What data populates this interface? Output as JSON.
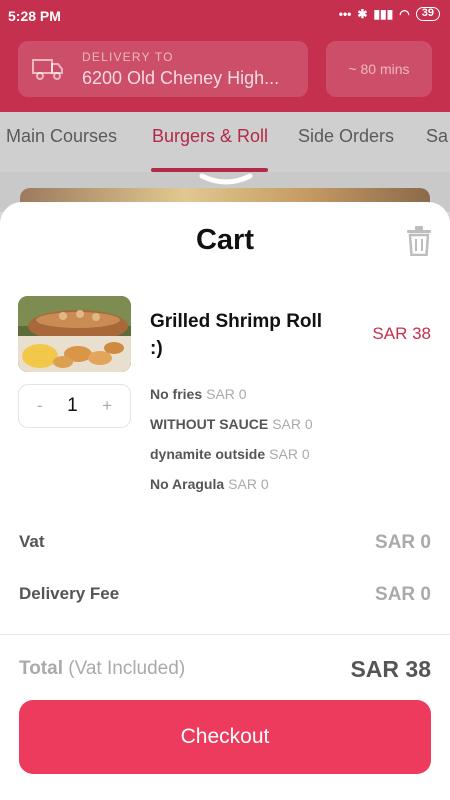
{
  "status": {
    "time": "5:28 PM",
    "battery": "39"
  },
  "header": {
    "delivery_label": "DELIVERY TO",
    "address": "6200 Old Cheney High...",
    "eta": "~ 80 mins"
  },
  "tabs": [
    {
      "label": "Main Courses"
    },
    {
      "label": "Burgers & Roll"
    },
    {
      "label": "Side Orders"
    },
    {
      "label": "Sa"
    }
  ],
  "cart": {
    "title": "Cart",
    "item": {
      "name": "Grilled Shrimp Roll :)",
      "price": "SAR 38",
      "quantity": "1",
      "minus": "-",
      "plus": "+",
      "options": [
        {
          "name": "No fries",
          "price": "SAR 0"
        },
        {
          "name": "WITHOUT SAUCE",
          "price": "SAR 0"
        },
        {
          "name": "dynamite outside",
          "price": "SAR 0"
        },
        {
          "name": "No Aragula",
          "price": "SAR 0"
        }
      ]
    },
    "vat_label": "Vat",
    "vat_value": "SAR 0",
    "delivery_fee_label": "Delivery Fee",
    "delivery_fee_value": "SAR 0",
    "total_label": "Total",
    "total_note": "(Vat Included)",
    "total_value": "SAR 38",
    "checkout_label": "Checkout"
  },
  "colors": {
    "brand": "#c5304e",
    "button": "#ec3b5c"
  }
}
